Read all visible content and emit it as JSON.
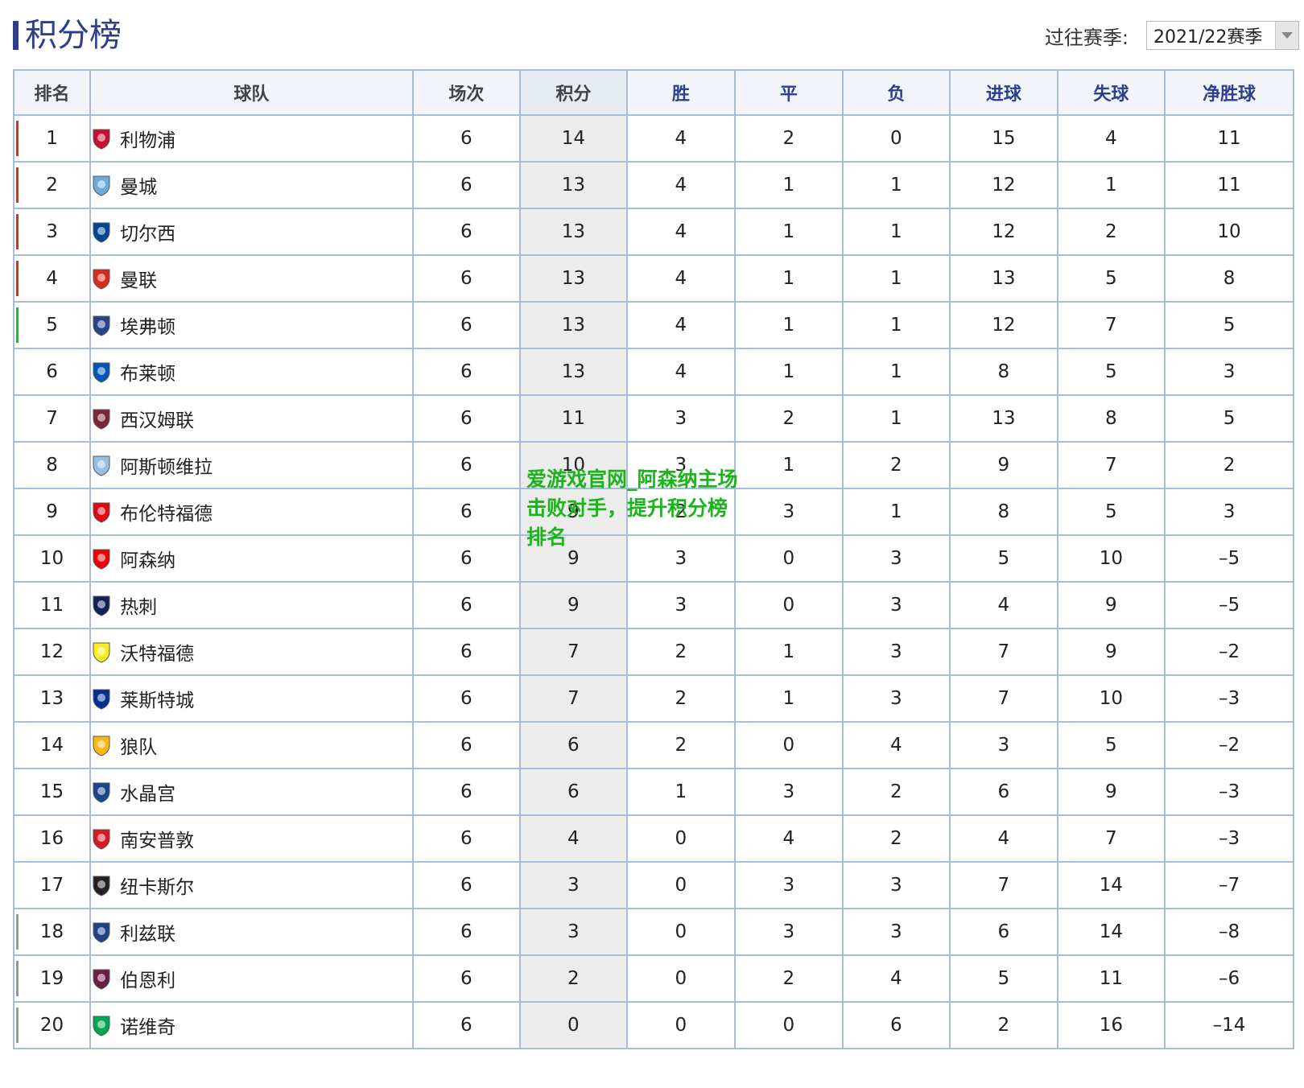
{
  "title": "积分榜",
  "season": {
    "label": "过往赛季:",
    "selected": "2021/22赛季"
  },
  "headers": {
    "rank": "排名",
    "team": "球队",
    "played": "场次",
    "points": "积分",
    "won": "胜",
    "drawn": "平",
    "lost": "负",
    "gf": "进球",
    "ga": "失球",
    "gd": "净胜球"
  },
  "colors": {
    "champions_league": "#b8402a",
    "europa_league": "#3aaa3a",
    "relegation": "#999999",
    "title_accent": "#2d3f8c"
  },
  "rows": [
    {
      "rank": "1",
      "team": "利物浦",
      "crest": "liverpool-crest-icon",
      "crest_color": "#c8102e",
      "played": "6",
      "points": "14",
      "won": "4",
      "drawn": "2",
      "lost": "0",
      "gf": "15",
      "ga": "4",
      "gd": "11",
      "zone": "champions_league"
    },
    {
      "rank": "2",
      "team": "曼城",
      "crest": "man-city-crest-icon",
      "crest_color": "#6cabdd",
      "played": "6",
      "points": "13",
      "won": "4",
      "drawn": "1",
      "lost": "1",
      "gf": "12",
      "ga": "1",
      "gd": "11",
      "zone": "champions_league"
    },
    {
      "rank": "3",
      "team": "切尔西",
      "crest": "chelsea-crest-icon",
      "crest_color": "#034694",
      "played": "6",
      "points": "13",
      "won": "4",
      "drawn": "1",
      "lost": "1",
      "gf": "12",
      "ga": "2",
      "gd": "10",
      "zone": "champions_league"
    },
    {
      "rank": "4",
      "team": "曼联",
      "crest": "man-united-crest-icon",
      "crest_color": "#da291c",
      "played": "6",
      "points": "13",
      "won": "4",
      "drawn": "1",
      "lost": "1",
      "gf": "13",
      "ga": "5",
      "gd": "8",
      "zone": "champions_league"
    },
    {
      "rank": "5",
      "team": "埃弗顿",
      "crest": "everton-crest-icon",
      "crest_color": "#274488",
      "played": "6",
      "points": "13",
      "won": "4",
      "drawn": "1",
      "lost": "1",
      "gf": "12",
      "ga": "7",
      "gd": "5",
      "zone": "europa_league"
    },
    {
      "rank": "6",
      "team": "布莱顿",
      "crest": "brighton-crest-icon",
      "crest_color": "#0057b8",
      "played": "6",
      "points": "13",
      "won": "4",
      "drawn": "1",
      "lost": "1",
      "gf": "8",
      "ga": "5",
      "gd": "3",
      "zone": ""
    },
    {
      "rank": "7",
      "team": "西汉姆联",
      "crest": "west-ham-crest-icon",
      "crest_color": "#7a263a",
      "played": "6",
      "points": "11",
      "won": "3",
      "drawn": "2",
      "lost": "1",
      "gf": "13",
      "ga": "8",
      "gd": "5",
      "zone": ""
    },
    {
      "rank": "8",
      "team": "阿斯顿维拉",
      "crest": "aston-villa-crest-icon",
      "crest_color": "#95bfe5",
      "played": "6",
      "points": "10",
      "won": "3",
      "drawn": "1",
      "lost": "2",
      "gf": "9",
      "ga": "7",
      "gd": "2",
      "zone": ""
    },
    {
      "rank": "9",
      "team": "布伦特福德",
      "crest": "brentford-crest-icon",
      "crest_color": "#e30613",
      "played": "6",
      "points": "9",
      "won": "2",
      "drawn": "3",
      "lost": "1",
      "gf": "8",
      "ga": "5",
      "gd": "3",
      "zone": ""
    },
    {
      "rank": "10",
      "team": "阿森纳",
      "crest": "arsenal-crest-icon",
      "crest_color": "#ef0107",
      "played": "6",
      "points": "9",
      "won": "3",
      "drawn": "0",
      "lost": "3",
      "gf": "5",
      "ga": "10",
      "gd": "–5",
      "zone": ""
    },
    {
      "rank": "11",
      "team": "热刺",
      "crest": "tottenham-crest-icon",
      "crest_color": "#132257",
      "played": "6",
      "points": "9",
      "won": "3",
      "drawn": "0",
      "lost": "3",
      "gf": "4",
      "ga": "9",
      "gd": "–5",
      "zone": ""
    },
    {
      "rank": "12",
      "team": "沃特福德",
      "crest": "watford-crest-icon",
      "crest_color": "#fbee23",
      "played": "6",
      "points": "7",
      "won": "2",
      "drawn": "1",
      "lost": "3",
      "gf": "7",
      "ga": "9",
      "gd": "–2",
      "zone": ""
    },
    {
      "rank": "13",
      "team": "莱斯特城",
      "crest": "leicester-crest-icon",
      "crest_color": "#003090",
      "played": "6",
      "points": "7",
      "won": "2",
      "drawn": "1",
      "lost": "3",
      "gf": "7",
      "ga": "10",
      "gd": "–3",
      "zone": ""
    },
    {
      "rank": "14",
      "team": "狼队",
      "crest": "wolves-crest-icon",
      "crest_color": "#fdb913",
      "played": "6",
      "points": "6",
      "won": "2",
      "drawn": "0",
      "lost": "4",
      "gf": "3",
      "ga": "5",
      "gd": "–2",
      "zone": ""
    },
    {
      "rank": "15",
      "team": "水晶宫",
      "crest": "crystal-palace-crest-icon",
      "crest_color": "#1b458f",
      "played": "6",
      "points": "6",
      "won": "1",
      "drawn": "3",
      "lost": "2",
      "gf": "6",
      "ga": "9",
      "gd": "–3",
      "zone": ""
    },
    {
      "rank": "16",
      "team": "南安普敦",
      "crest": "southampton-crest-icon",
      "crest_color": "#d71920",
      "played": "6",
      "points": "4",
      "won": "0",
      "drawn": "4",
      "lost": "2",
      "gf": "4",
      "ga": "7",
      "gd": "–3",
      "zone": ""
    },
    {
      "rank": "17",
      "team": "纽卡斯尔",
      "crest": "newcastle-crest-icon",
      "crest_color": "#241f20",
      "played": "6",
      "points": "3",
      "won": "0",
      "drawn": "3",
      "lost": "3",
      "gf": "7",
      "ga": "14",
      "gd": "–7",
      "zone": ""
    },
    {
      "rank": "18",
      "team": "利兹联",
      "crest": "leeds-crest-icon",
      "crest_color": "#1d428a",
      "played": "6",
      "points": "3",
      "won": "0",
      "drawn": "3",
      "lost": "3",
      "gf": "6",
      "ga": "14",
      "gd": "–8",
      "zone": "relegation"
    },
    {
      "rank": "19",
      "team": "伯恩利",
      "crest": "burnley-crest-icon",
      "crest_color": "#6c1d45",
      "played": "6",
      "points": "2",
      "won": "0",
      "drawn": "2",
      "lost": "4",
      "gf": "5",
      "ga": "11",
      "gd": "–6",
      "zone": "relegation"
    },
    {
      "rank": "20",
      "team": "诺维奇",
      "crest": "norwich-crest-icon",
      "crest_color": "#00a650",
      "played": "6",
      "points": "0",
      "won": "0",
      "drawn": "0",
      "lost": "6",
      "gf": "2",
      "ga": "16",
      "gd": "–14",
      "zone": "relegation"
    }
  ],
  "watermark": "爱游戏官网_阿森纳主场击败对手，提升积分榜排名"
}
